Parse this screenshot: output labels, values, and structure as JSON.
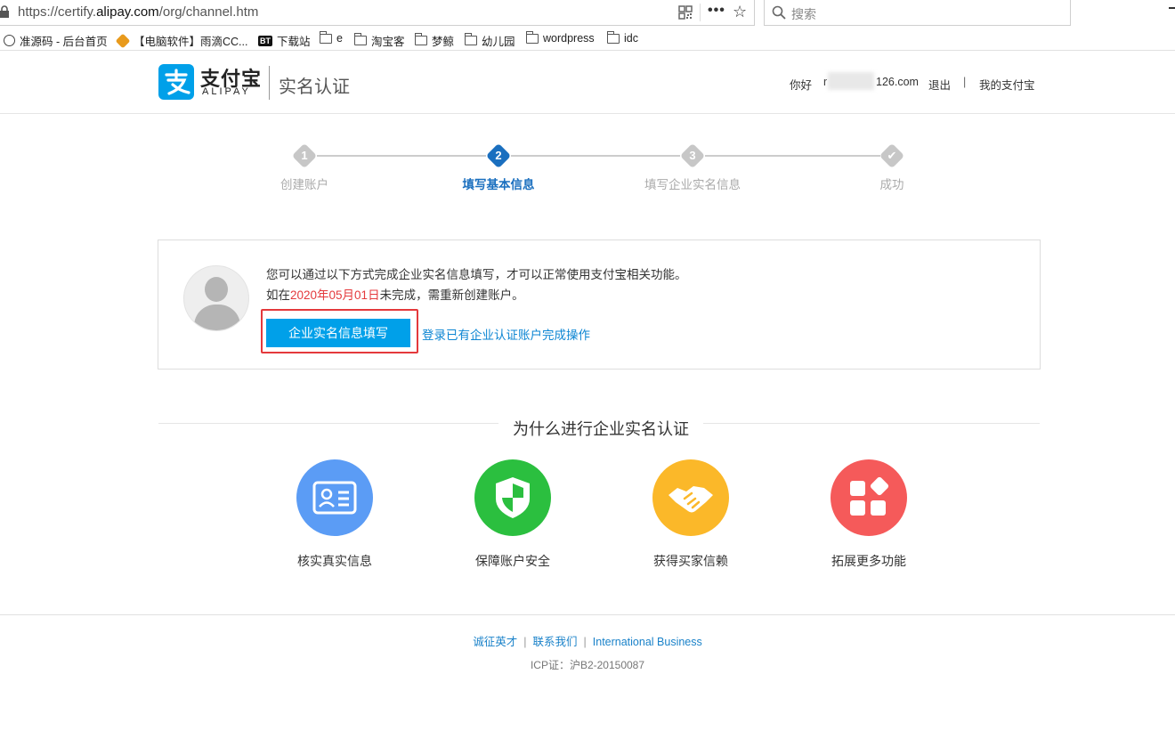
{
  "browser": {
    "url_prefix": "https://certify.",
    "url_domain": "alipay.com",
    "url_path": "/org/channel.htm",
    "more_label": "•••",
    "search_placeholder": "搜索",
    "bookmarks": [
      {
        "label": "准源码 - 后台首页",
        "icon": "globe-icon"
      },
      {
        "label": "【电脑软件】雨滴CC...",
        "icon": "shield-icon"
      },
      {
        "label": "下载站",
        "icon": "bt-icon",
        "icon_text": "BT"
      },
      {
        "label": "e",
        "icon": "folder-icon"
      },
      {
        "label": "淘宝客",
        "icon": "folder-icon"
      },
      {
        "label": "梦鲸",
        "icon": "folder-icon"
      },
      {
        "label": "幼儿园",
        "icon": "folder-icon"
      },
      {
        "label": "wordpress",
        "icon": "folder-icon"
      },
      {
        "label": "idc",
        "icon": "folder-icon"
      }
    ]
  },
  "header": {
    "logo_cn": "支付宝",
    "logo_en": "ALIPAY",
    "subtitle": "实名认证",
    "greeting": "你好",
    "user_prefix": "r",
    "user_suffix": "126.com",
    "logout": "退出",
    "separator": "|",
    "my_alipay": "我的支付宝"
  },
  "steps": [
    {
      "number": "1",
      "label": "创建账户",
      "state": "done"
    },
    {
      "number": "2",
      "label": "填写基本信息",
      "state": "active"
    },
    {
      "number": "3",
      "label": "填写企业实名信息",
      "state": "pending"
    },
    {
      "number": "✔",
      "label": "成功",
      "state": "pending"
    }
  ],
  "card": {
    "line1": "您可以通过以下方式完成企业实名信息填写，才可以正常使用支付宝相关功能。",
    "line2_prefix": "如在",
    "line2_date": "2020年05月01日",
    "line2_suffix": "未完成，需重新创建账户。",
    "primary_button": "企业实名信息填写",
    "alt_link": "登录已有企业认证账户完成操作"
  },
  "why": {
    "title": "为什么进行企业实名认证",
    "features": [
      {
        "label": "核实真实信息",
        "icon": "id-card-icon",
        "color": "#5b9cf5"
      },
      {
        "label": "保障账户安全",
        "icon": "shield-check-icon",
        "color": "#2bbf3f"
      },
      {
        "label": "获得买家信赖",
        "icon": "handshake-icon",
        "color": "#fbb829"
      },
      {
        "label": "拓展更多功能",
        "icon": "apps-icon",
        "color": "#f55a5a"
      }
    ]
  },
  "footer": {
    "links": [
      "诚征英才",
      "联系我们",
      "International Business"
    ],
    "sep": "|",
    "icp": "ICP证：沪B2-20150087"
  },
  "colors": {
    "brand_blue": "#00a0e9",
    "active_step": "#1a6fbf",
    "highlight_red": "#e4393c",
    "link_blue": "#0d86d3"
  }
}
